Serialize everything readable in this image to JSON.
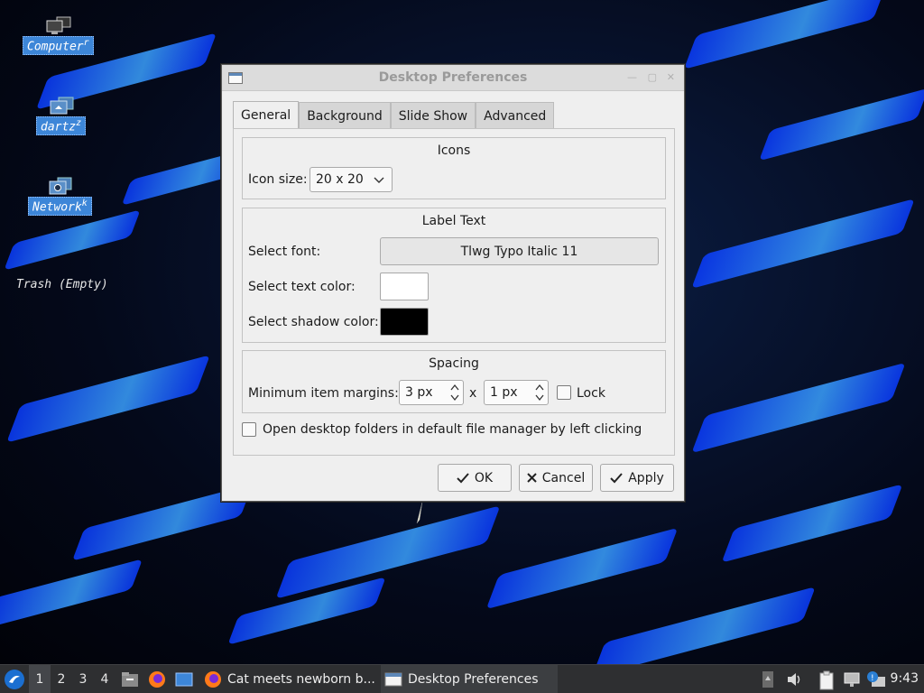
{
  "desktop": {
    "icons": [
      {
        "label": "Computer",
        "suffix": "r"
      },
      {
        "label": "dartz",
        "suffix": "z"
      },
      {
        "label": "Network",
        "suffix": "k"
      }
    ],
    "trash": "Trash (Empty)"
  },
  "window": {
    "title": "Desktop Preferences",
    "controls": {
      "minimize": "—",
      "maximize": "▢",
      "close": "✕"
    },
    "tabs": [
      {
        "label": "General",
        "active": true
      },
      {
        "label": "Background",
        "active": false
      },
      {
        "label": "Slide Show",
        "active": false
      },
      {
        "label": "Advanced",
        "active": false
      }
    ],
    "icons_group": {
      "title": "Icons",
      "icon_size_label": "Icon size:",
      "icon_size_value": "20 x 20"
    },
    "label_text_group": {
      "title": "Label Text",
      "font_label": "Select font:",
      "font_value": "Tlwg Typo Italic 11",
      "text_color_label": "Select text color:",
      "text_color": "#ffffff",
      "shadow_color_label": "Select shadow color:",
      "shadow_color": "#000000"
    },
    "spacing_group": {
      "title": "Spacing",
      "margins_label": "Minimum item margins:",
      "margin_x": "3 px",
      "separator": "x",
      "margin_y": "1 px",
      "lock_label": "Lock",
      "lock_checked": false
    },
    "open_folders_label": "Open desktop folders in default file manager by left clicking",
    "open_folders_checked": false,
    "buttons": {
      "ok": "OK",
      "cancel": "Cancel",
      "apply": "Apply"
    }
  },
  "taskbar": {
    "workspaces": [
      "1",
      "2",
      "3",
      "4"
    ],
    "active_workspace": "1",
    "tasks": [
      {
        "label": "Cat meets newborn b...",
        "icon": "firefox-icon"
      },
      {
        "label": "Desktop Preferences",
        "icon": "window-icon"
      }
    ],
    "clock": "9:43"
  },
  "colors": {
    "accent": "#3d86d8",
    "taskbar_bg": "#2e2f31",
    "window_bg": "#efefef"
  }
}
